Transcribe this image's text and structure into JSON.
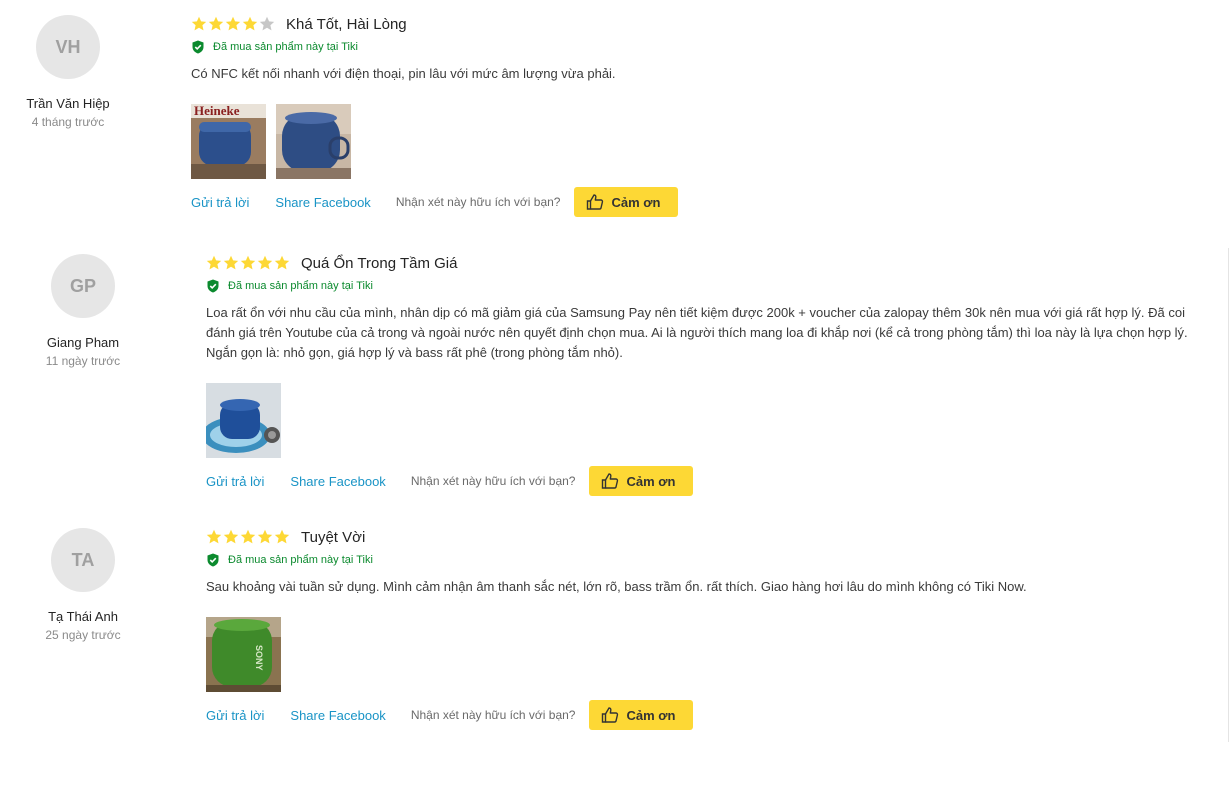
{
  "colors": {
    "star": "#fdd835",
    "star_empty": "#c7c7c7",
    "verified": "#0b8a2e",
    "link": "#1a94c6",
    "thanks_button": "#fdd835"
  },
  "reviews": [
    {
      "initials": "VH",
      "name": "Trần Văn Hiệp",
      "time": "4 tháng trước",
      "rating": 4,
      "title": "Khá Tốt, Hài Lòng",
      "verified": "Đã mua sản phẩm này tại Tiki",
      "content": "Có NFC kết nối nhanh với điện thoại, pin lâu với mức âm lượng vừa phải.",
      "photos": [
        {
          "desc": "blue Sony speaker photo 1"
        },
        {
          "desc": "blue Sony speaker photo 2"
        }
      ],
      "reply_label": "Gửi trả lời",
      "share_label": "Share Facebook",
      "useful_question": "Nhận xét này hữu ích với bạn?",
      "thanks_label": "Cảm ơn"
    },
    {
      "initials": "GP",
      "name": "Giang Pham",
      "time": "11 ngày trước",
      "rating": 5,
      "title": "Quá Ổn Trong Tầm Giá",
      "verified": "Đã mua sản phẩm này tại Tiki",
      "content": "Loa rất ổn với nhu cầu của mình, nhân dịp có mã giảm giá của Samsung Pay nên tiết kiệm được 200k + voucher của zalopay thêm 30k nên mua với giá rất hợp lý. Đã coi đánh giá trên Youtube của cả trong và ngoài nước nên quyết định chọn mua. Ai là người thích mang loa đi khắp nơi (kể cả trong phòng tắm) thì loa này là lựa chọn hợp lý. Ngắn gọn là: nhỏ gọn, giá hợp lý và bass rất phê (trong phòng tắm nhỏ).",
      "photos": [
        {
          "desc": "blue speaker on table"
        }
      ],
      "reply_label": "Gửi trả lời",
      "share_label": "Share Facebook",
      "useful_question": "Nhận xét này hữu ích với bạn?",
      "thanks_label": "Cảm ơn"
    },
    {
      "initials": "TA",
      "name": "Tạ Thái Anh",
      "time": "25 ngày trước",
      "rating": 5,
      "title": "Tuyệt Vời",
      "verified": "Đã mua sản phẩm này tại Tiki",
      "content": "Sau khoảng vài tuần sử dụng. Mình cảm nhận âm thanh sắc nét, lớn rõ, bass trầm ổn. rất thích. Giao hàng hơi lâu do mình không có Tiki Now.",
      "photos": [
        {
          "desc": "green Sony speaker"
        }
      ],
      "reply_label": "Gửi trả lời",
      "share_label": "Share Facebook",
      "useful_question": "Nhận xét này hữu ích với bạn?",
      "thanks_label": "Cảm ơn"
    }
  ]
}
